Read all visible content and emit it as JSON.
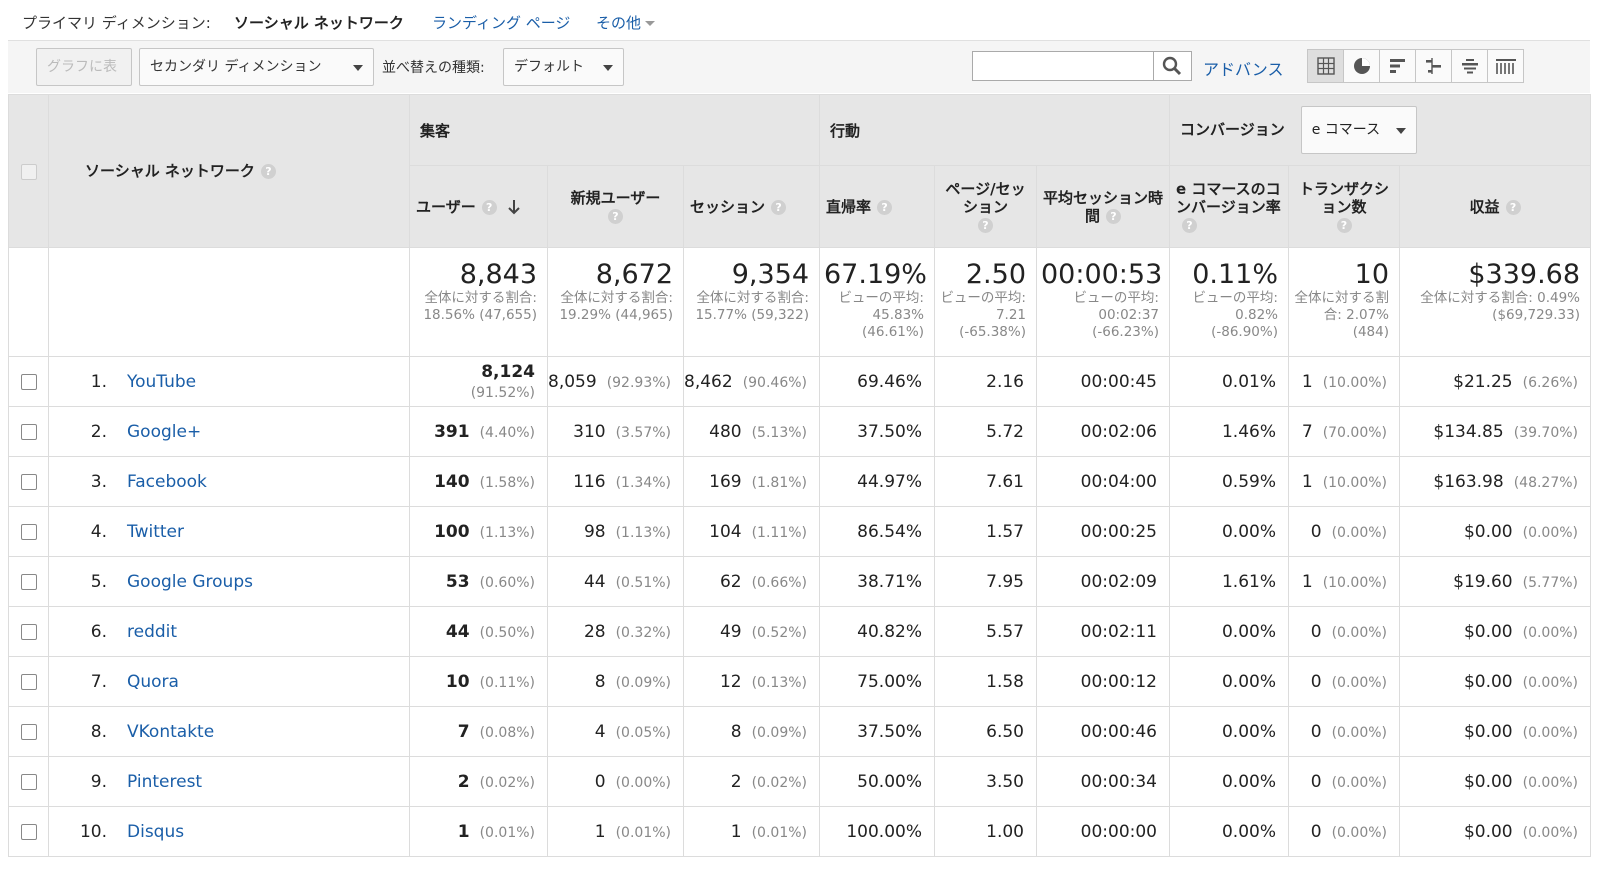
{
  "dimension_bar": {
    "label": "プライマリ ディメンション:",
    "current": "ソーシャル ネットワーク",
    "link1": "ランディング ページ",
    "link2": "その他"
  },
  "toolbar": {
    "chart_btn": "グラフに表示",
    "secondary_dim": "セカンダリ ディメンション",
    "sort_label": "並べ替えの種類:",
    "sort_value": "デフォルト",
    "search_value": "",
    "advance": "アドバンス"
  },
  "header": {
    "dimension_col": "ソーシャル ネットワーク",
    "groups": {
      "acquisition": "集客",
      "behavior": "行動",
      "conversion": "コンバージョン"
    },
    "conversion_select": "e コマース",
    "cols": {
      "users": "ユーザー",
      "new_users": "新規ユーザー",
      "sessions": "セッション",
      "bounce": "直帰率",
      "pages": "ページ/セッション",
      "duration": "平均セッション時間",
      "ecom_rate": "e コマースのコンバージョン率",
      "transactions": "トランザクション数",
      "revenue": "収益"
    }
  },
  "totals": {
    "users": {
      "big": "8,843",
      "sub": "全体に対する割合: 18.56% (47,655)"
    },
    "new_users": {
      "big": "8,672",
      "sub": "全体に対する割合: 19.29% (44,965)"
    },
    "sessions": {
      "big": "9,354",
      "sub": "全体に対する割合: 15.77% (59,322)"
    },
    "bounce": {
      "big": "67.19%",
      "sub": "ビューの平均: 45.83% (46.61%)"
    },
    "pages": {
      "big": "2.50",
      "sub": "ビューの平均: 7.21 (-65.38%)"
    },
    "duration": {
      "big": "00:00:53",
      "sub": "ビューの平均: 00:02:37 (-66.23%)"
    },
    "ecom_rate": {
      "big": "0.11%",
      "sub": "ビューの平均: 0.82% (-86.90%)"
    },
    "transactions": {
      "big": "10",
      "sub": "全体に対する割合: 2.07% (484)"
    },
    "revenue": {
      "big": "$339.68",
      "sub": "全体に対する割合: 0.49% ($69,729.33)"
    }
  },
  "rows": [
    {
      "idx": "1.",
      "name": "YouTube",
      "users": "8,124",
      "users_p": "(91.52%)",
      "new": "8,059",
      "new_p": "(92.93%)",
      "sess": "8,462",
      "sess_p": "(90.46%)",
      "bounce": "69.46%",
      "pages": "2.16",
      "dur": "00:00:45",
      "conv": "0.01%",
      "tx": "1",
      "tx_p": "(10.00%)",
      "rev": "$21.25",
      "rev_p": "(6.26%)"
    },
    {
      "idx": "2.",
      "name": "Google+",
      "users": "391",
      "users_p": "(4.40%)",
      "new": "310",
      "new_p": "(3.57%)",
      "sess": "480",
      "sess_p": "(5.13%)",
      "bounce": "37.50%",
      "pages": "5.72",
      "dur": "00:02:06",
      "conv": "1.46%",
      "tx": "7",
      "tx_p": "(70.00%)",
      "rev": "$134.85",
      "rev_p": "(39.70%)"
    },
    {
      "idx": "3.",
      "name": "Facebook",
      "users": "140",
      "users_p": "(1.58%)",
      "new": "116",
      "new_p": "(1.34%)",
      "sess": "169",
      "sess_p": "(1.81%)",
      "bounce": "44.97%",
      "pages": "7.61",
      "dur": "00:04:00",
      "conv": "0.59%",
      "tx": "1",
      "tx_p": "(10.00%)",
      "rev": "$163.98",
      "rev_p": "(48.27%)"
    },
    {
      "idx": "4.",
      "name": "Twitter",
      "users": "100",
      "users_p": "(1.13%)",
      "new": "98",
      "new_p": "(1.13%)",
      "sess": "104",
      "sess_p": "(1.11%)",
      "bounce": "86.54%",
      "pages": "1.57",
      "dur": "00:00:25",
      "conv": "0.00%",
      "tx": "0",
      "tx_p": "(0.00%)",
      "rev": "$0.00",
      "rev_p": "(0.00%)"
    },
    {
      "idx": "5.",
      "name": "Google Groups",
      "users": "53",
      "users_p": "(0.60%)",
      "new": "44",
      "new_p": "(0.51%)",
      "sess": "62",
      "sess_p": "(0.66%)",
      "bounce": "38.71%",
      "pages": "7.95",
      "dur": "00:02:09",
      "conv": "1.61%",
      "tx": "1",
      "tx_p": "(10.00%)",
      "rev": "$19.60",
      "rev_p": "(5.77%)"
    },
    {
      "idx": "6.",
      "name": "reddit",
      "users": "44",
      "users_p": "(0.50%)",
      "new": "28",
      "new_p": "(0.32%)",
      "sess": "49",
      "sess_p": "(0.52%)",
      "bounce": "40.82%",
      "pages": "5.57",
      "dur": "00:02:11",
      "conv": "0.00%",
      "tx": "0",
      "tx_p": "(0.00%)",
      "rev": "$0.00",
      "rev_p": "(0.00%)"
    },
    {
      "idx": "7.",
      "name": "Quora",
      "users": "10",
      "users_p": "(0.11%)",
      "new": "8",
      "new_p": "(0.09%)",
      "sess": "12",
      "sess_p": "(0.13%)",
      "bounce": "75.00%",
      "pages": "1.58",
      "dur": "00:00:12",
      "conv": "0.00%",
      "tx": "0",
      "tx_p": "(0.00%)",
      "rev": "$0.00",
      "rev_p": "(0.00%)"
    },
    {
      "idx": "8.",
      "name": "VKontakte",
      "users": "7",
      "users_p": "(0.08%)",
      "new": "4",
      "new_p": "(0.05%)",
      "sess": "8",
      "sess_p": "(0.09%)",
      "bounce": "37.50%",
      "pages": "6.50",
      "dur": "00:00:46",
      "conv": "0.00%",
      "tx": "0",
      "tx_p": "(0.00%)",
      "rev": "$0.00",
      "rev_p": "(0.00%)"
    },
    {
      "idx": "9.",
      "name": "Pinterest",
      "users": "2",
      "users_p": "(0.02%)",
      "new": "0",
      "new_p": "(0.00%)",
      "sess": "2",
      "sess_p": "(0.02%)",
      "bounce": "50.00%",
      "pages": "3.50",
      "dur": "00:00:34",
      "conv": "0.00%",
      "tx": "0",
      "tx_p": "(0.00%)",
      "rev": "$0.00",
      "rev_p": "(0.00%)"
    },
    {
      "idx": "10.",
      "name": "Disqus",
      "users": "1",
      "users_p": "(0.01%)",
      "new": "1",
      "new_p": "(0.01%)",
      "sess": "1",
      "sess_p": "(0.01%)",
      "bounce": "100.00%",
      "pages": "1.00",
      "dur": "00:00:00",
      "conv": "0.00%",
      "tx": "0",
      "tx_p": "(0.00%)",
      "rev": "$0.00",
      "rev_p": "(0.00%)"
    }
  ],
  "icons": {
    "search": "search-icon",
    "views": [
      "table-view-icon",
      "pie-view-icon",
      "performance-view-icon",
      "comparison-view-icon",
      "term-cloud-icon",
      "pivot-view-icon"
    ]
  },
  "colors": {
    "link": "#1a5ea8",
    "header_bg": "#e6e6e6"
  }
}
